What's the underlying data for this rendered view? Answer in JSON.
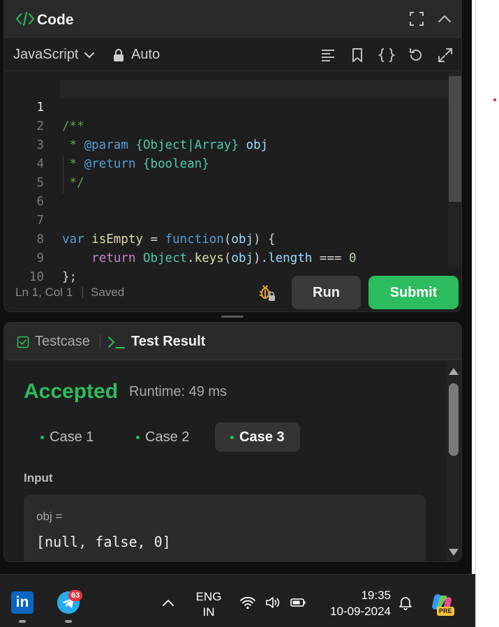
{
  "code_panel": {
    "title": "Code",
    "language": "JavaScript",
    "mode": "Auto",
    "lines": [
      {
        "n": "1"
      },
      {
        "n": "2"
      },
      {
        "n": "3"
      },
      {
        "n": "4"
      },
      {
        "n": "5"
      },
      {
        "n": "6"
      },
      {
        "n": "7"
      },
      {
        "n": "8"
      },
      {
        "n": "9"
      },
      {
        "n": "10"
      }
    ],
    "status": {
      "position": "Ln 1, Col 1",
      "saved": "Saved"
    },
    "run_label": "Run",
    "submit_label": "Submit"
  },
  "test_panel": {
    "tab_testcase": "Testcase",
    "tab_result": "Test Result",
    "result": "Accepted",
    "runtime": "Runtime: 49 ms",
    "cases": [
      "Case 1",
      "Case 2",
      "Case 3"
    ],
    "input_label": "Input",
    "input_var": "obj =",
    "input_value": "[null, false, 0]"
  },
  "taskbar": {
    "linkedin_label": "in",
    "telegram_badge": "63",
    "lang_line1": "ENG",
    "lang_line2": "IN",
    "time": "19:35",
    "date": "10-09-2024",
    "copilot_badge": "PRE"
  },
  "colors": {
    "accent_green": "#2cbb5d",
    "panel_bg": "#1e1e1e",
    "header_bg": "#2a2a2a"
  }
}
